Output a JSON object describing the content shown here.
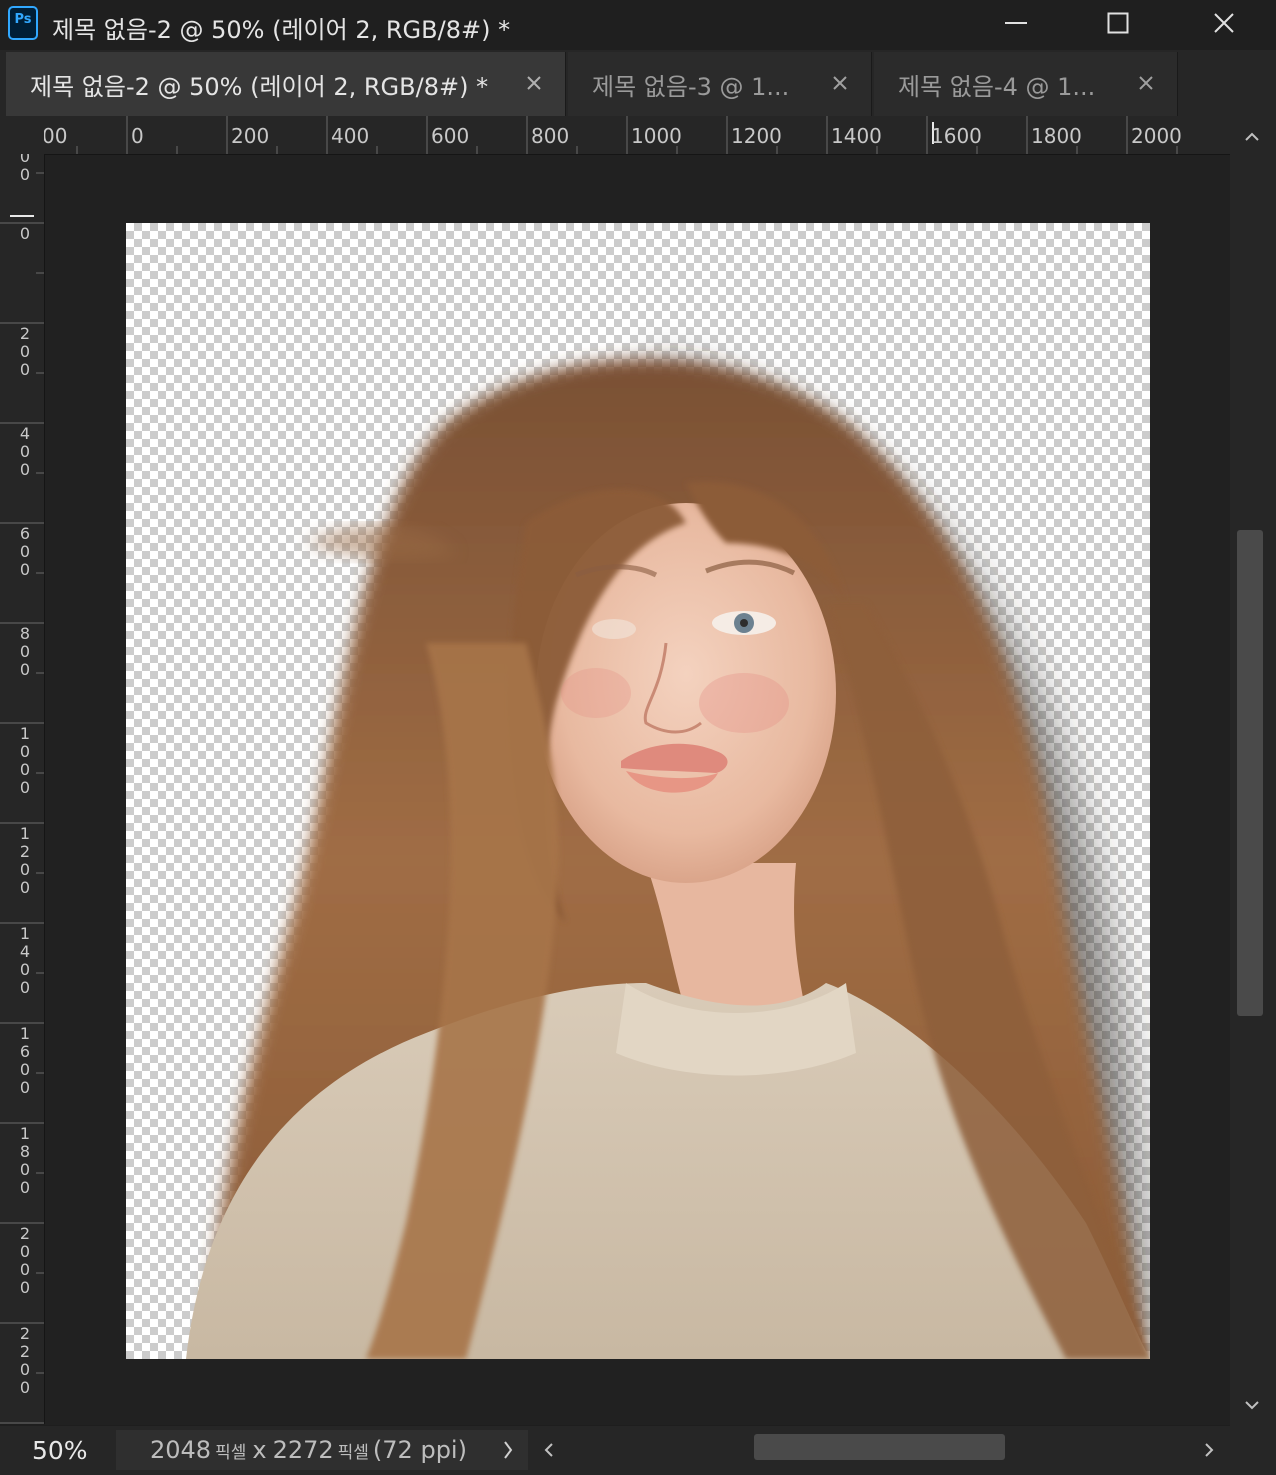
{
  "window": {
    "app_icon_text": "Ps",
    "title": "제목 없음-2 @ 50% (레이어 2, RGB/8#) *"
  },
  "tabs": [
    {
      "label": "제목 없음-2 @ 50% (레이어 2, RGB/8#) *",
      "active": true
    },
    {
      "label": "제목 없음-3 @ 1...",
      "active": false
    },
    {
      "label": "제목 없음-4 @ 1...",
      "active": false
    }
  ],
  "ruler_top": {
    "labels": [
      "00",
      "0",
      "200",
      "400",
      "600",
      "800",
      "1000",
      "1200",
      "1400",
      "1600",
      "1800",
      "2000"
    ]
  },
  "ruler_left": {
    "labels": [
      [
        "0",
        "0"
      ],
      [
        "0"
      ],
      [
        "2",
        "0",
        "0"
      ],
      [
        "4",
        "0",
        "0"
      ],
      [
        "6",
        "0",
        "0"
      ],
      [
        "8",
        "0",
        "0"
      ],
      [
        "1",
        "0",
        "0",
        "0"
      ],
      [
        "1",
        "2",
        "0",
        "0"
      ],
      [
        "1",
        "4",
        "0",
        "0"
      ],
      [
        "1",
        "6",
        "0",
        "0"
      ],
      [
        "1",
        "8",
        "0",
        "0"
      ],
      [
        "2",
        "0",
        "0",
        "0"
      ],
      [
        "2",
        "2",
        "0",
        "0"
      ]
    ]
  },
  "canvas": {
    "description_icon": "portrait-layer"
  },
  "status": {
    "zoom": "50%",
    "width_value": "2048",
    "unit": "픽셀",
    "times": "x",
    "height_value": "2272",
    "resolution": "(72 ppi)"
  },
  "colors": {
    "ps_blue": "#31a8ff",
    "panel": "#262626",
    "workspace": "#212121"
  }
}
